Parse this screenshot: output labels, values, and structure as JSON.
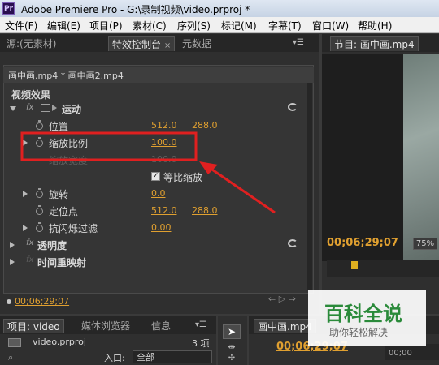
{
  "app": {
    "logo": "Pr",
    "title": "Adobe Premiere Pro - G:\\录制视频\\video.prproj *"
  },
  "menu": [
    "文件(F)",
    "编辑(E)",
    "项目(P)",
    "素材(C)",
    "序列(S)",
    "标记(M)",
    "字幕(T)",
    "窗口(W)",
    "帮助(H)"
  ],
  "effect_controls": {
    "tabs": [
      "源:(无素材)",
      "特效控制台",
      "元数据"
    ],
    "clip_path": "画中画.mp4 * 画中画2.mp4",
    "section_title": "视频效果",
    "motion_label": "运动",
    "rows": {
      "position": {
        "label": "位置",
        "x": "512.0",
        "y": "288.0"
      },
      "scale": {
        "label": "缩放比例",
        "value": "100.0"
      },
      "scale_width": {
        "label": "缩放宽度",
        "value": "100.0"
      },
      "uniform_scale": "等比缩放",
      "rotation": {
        "label": "旋转",
        "value": "0.0"
      },
      "anchor": {
        "label": "定位点",
        "x": "512.0",
        "y": "288.0"
      },
      "anti_flicker": {
        "label": "抗闪烁过滤",
        "value": "0.00"
      }
    },
    "opacity_label": "透明度",
    "time_remap_label": "时间重映射",
    "timecode": "00;06;29;07"
  },
  "program_monitor": {
    "tab": "节目: 画中画.mp4",
    "timecode": "00;06;29;07",
    "zoom": "75%"
  },
  "project": {
    "tabs": [
      "项目: video",
      "媒体浏览器",
      "信息"
    ],
    "file": "video.prproj",
    "count": "3 项",
    "entry_label": "入口:",
    "entry_value": "全部"
  },
  "timeline": {
    "tab": "画中画.mp4",
    "timecode": "00;06;29;07",
    "ruler": "00;00"
  },
  "watermark": {
    "title": "百科全说",
    "subtitle": "助你轻松解决"
  },
  "colors": {
    "accent": "#e0a030",
    "highlight": "#e02020"
  }
}
